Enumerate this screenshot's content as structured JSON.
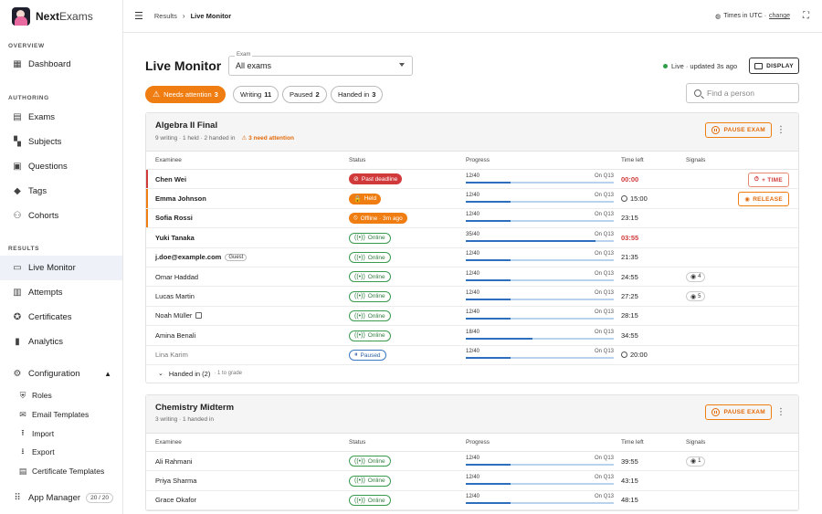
{
  "app": {
    "name_bold": "Next",
    "name_rest": "Exams"
  },
  "sidebar": {
    "overview_label": "OVERVIEW",
    "dashboard": "Dashboard",
    "authoring_label": "AUTHORING",
    "authoring": [
      {
        "label": "Exams",
        "icon": "exam-icon"
      },
      {
        "label": "Subjects",
        "icon": "subjects-icon"
      },
      {
        "label": "Questions",
        "icon": "questions-icon"
      },
      {
        "label": "Tags",
        "icon": "tag-icon"
      },
      {
        "label": "Cohorts",
        "icon": "cohorts-icon"
      }
    ],
    "results_label": "RESULTS",
    "results": [
      {
        "label": "Live Monitor",
        "icon": "monitor-icon"
      },
      {
        "label": "Attempts",
        "icon": "attempts-icon"
      },
      {
        "label": "Certificates",
        "icon": "certificate-icon"
      },
      {
        "label": "Analytics",
        "icon": "analytics-icon"
      }
    ],
    "configuration": "Configuration",
    "config_items": [
      {
        "label": "Roles",
        "icon": "roles-icon"
      },
      {
        "label": "Email Templates",
        "icon": "email-icon"
      },
      {
        "label": "Import",
        "icon": "import-icon"
      },
      {
        "label": "Export",
        "icon": "export-icon"
      },
      {
        "label": "Certificate Templates",
        "icon": "document-icon"
      }
    ],
    "app_manager": "App Manager",
    "app_count": "20 / 20"
  },
  "topbar": {
    "crumb_root": "Results",
    "crumb_current": "Live Monitor",
    "tz_text": "Times in UTC ·",
    "tz_change": "change"
  },
  "page": {
    "title": "Live Monitor",
    "exam_select_label": "Exam",
    "exam_select_value": "All exams",
    "live_status": "Live · updated 3s ago",
    "display_button": "DISPLAY",
    "search_placeholder": "Find a person"
  },
  "filters": [
    {
      "label": "Needs attention",
      "count": "3"
    },
    {
      "label": "Writing",
      "count": "11"
    },
    {
      "label": "Paused",
      "count": "2"
    },
    {
      "label": "Handed in",
      "count": "3"
    }
  ],
  "table_headers": {
    "examinee": "Examinee",
    "status": "Status",
    "progress": "Progress",
    "time_left": "Time left",
    "signals": "Signals"
  },
  "exams": [
    {
      "title": "Algebra II Final",
      "subtitle": "9 writing · 1 held · 2 handed in",
      "attention": "3 need attention",
      "pause_label": "PAUSE EXAM",
      "rows": [
        {
          "name": "Chen Wei",
          "status": "Past deadline",
          "progress": "12/40",
          "q": "On Q13",
          "fraction": 0.3,
          "time": "00:00",
          "action": "+ TIME"
        },
        {
          "name": "Emma Johnson",
          "status": "Held",
          "progress": "12/40",
          "q": "On Q13",
          "fraction": 0.3,
          "time": "15:00",
          "action": "RELEASE"
        },
        {
          "name": "Sofia Rossi",
          "status": "Offline · 3m ago",
          "progress": "12/40",
          "q": "On Q13",
          "fraction": 0.3,
          "time": "23:15"
        },
        {
          "name": "Yuki Tanaka",
          "status": "Online",
          "progress": "35/40",
          "q": "On Q13",
          "fraction": 0.875,
          "time": "03:55"
        },
        {
          "name": "j.doe@example.com",
          "guest": "Guest",
          "status": "Online",
          "progress": "12/40",
          "q": "On Q13",
          "fraction": 0.3,
          "time": "21:35"
        },
        {
          "name": "Omar Haddad",
          "status": "Online",
          "progress": "12/40",
          "q": "On Q13",
          "fraction": 0.3,
          "time": "24:55",
          "signal": "4"
        },
        {
          "name": "Lucas Martin",
          "status": "Online",
          "progress": "12/40",
          "q": "On Q13",
          "fraction": 0.3,
          "time": "27:25",
          "signal": "5"
        },
        {
          "name": "Noah Müller",
          "status": "Online",
          "progress": "12/40",
          "q": "On Q13",
          "fraction": 0.3,
          "time": "28:15"
        },
        {
          "name": "Amina Benali",
          "status": "Online",
          "progress": "18/40",
          "q": "On Q13",
          "fraction": 0.45,
          "time": "34:55"
        },
        {
          "name": "Lina Karim",
          "status": "Paused",
          "progress": "12/40",
          "q": "On Q13",
          "fraction": 0.3,
          "time": "20:00"
        }
      ],
      "handed_label": "Handed in (2)",
      "handed_sub": "· 1 to grade"
    },
    {
      "title": "Chemistry Midterm",
      "subtitle": "3 writing · 1 handed in",
      "pause_label": "PAUSE EXAM",
      "rows": [
        {
          "name": "Ali Rahmani",
          "status": "Online",
          "progress": "12/40",
          "q": "On Q13",
          "fraction": 0.3,
          "time": "39:55",
          "signal": "1"
        },
        {
          "name": "Priya Sharma",
          "status": "Online",
          "progress": "12/40",
          "q": "On Q13",
          "fraction": 0.3,
          "time": "43:15"
        },
        {
          "name": "Grace Okafor",
          "status": "Online",
          "progress": "12/40",
          "q": "On Q13",
          "fraction": 0.3,
          "time": "48:15"
        }
      ]
    }
  ],
  "colors": {
    "accent_orange": "#ef7d12",
    "danger_red": "#d03a3a",
    "online_green": "#3a9a4e",
    "progress_blue": "#2d6fbe"
  }
}
